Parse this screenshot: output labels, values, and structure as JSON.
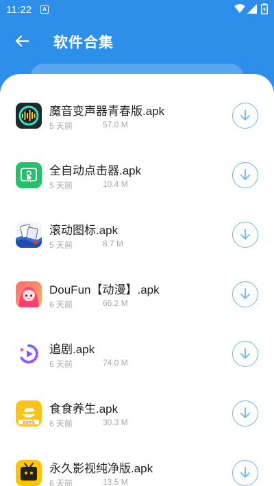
{
  "status_bar": {
    "time": "11:22",
    "notif_letter": "A"
  },
  "app_bar": {
    "title": "软件合集"
  },
  "colors": {
    "primary": "#2d8fea",
    "download_accent": "#6ab5f3",
    "meta_text": "#a8a8a8"
  },
  "files": [
    {
      "name": "魔音变声器青春版.apk",
      "time": "5 天前",
      "size": "57.0 M",
      "icon": "voice-changer-icon"
    },
    {
      "name": "全自动点击器.apk",
      "time": "5 天前",
      "size": "10.4 M",
      "icon": "auto-clicker-icon"
    },
    {
      "name": "滚动图标.apk",
      "time": "5 天前",
      "size": "8.7 M",
      "icon": "scroll-icon-app-icon"
    },
    {
      "name": "DouFun【动漫】.apk",
      "time": "6 天前",
      "size": "66.2 M",
      "icon": "doufun-icon"
    },
    {
      "name": "追剧.apk",
      "time": "6 天前",
      "size": "74.0 M",
      "icon": "drama-play-icon"
    },
    {
      "name": "食食养生.apk",
      "time": "6 天前",
      "size": "30.3 M",
      "icon": "food-health-icon"
    },
    {
      "name": "永久影视纯净版.apk",
      "time": "6 天前",
      "size": "13.5 M",
      "icon": "movie-tv-icon"
    }
  ],
  "food_icon_caption": "食食养生"
}
